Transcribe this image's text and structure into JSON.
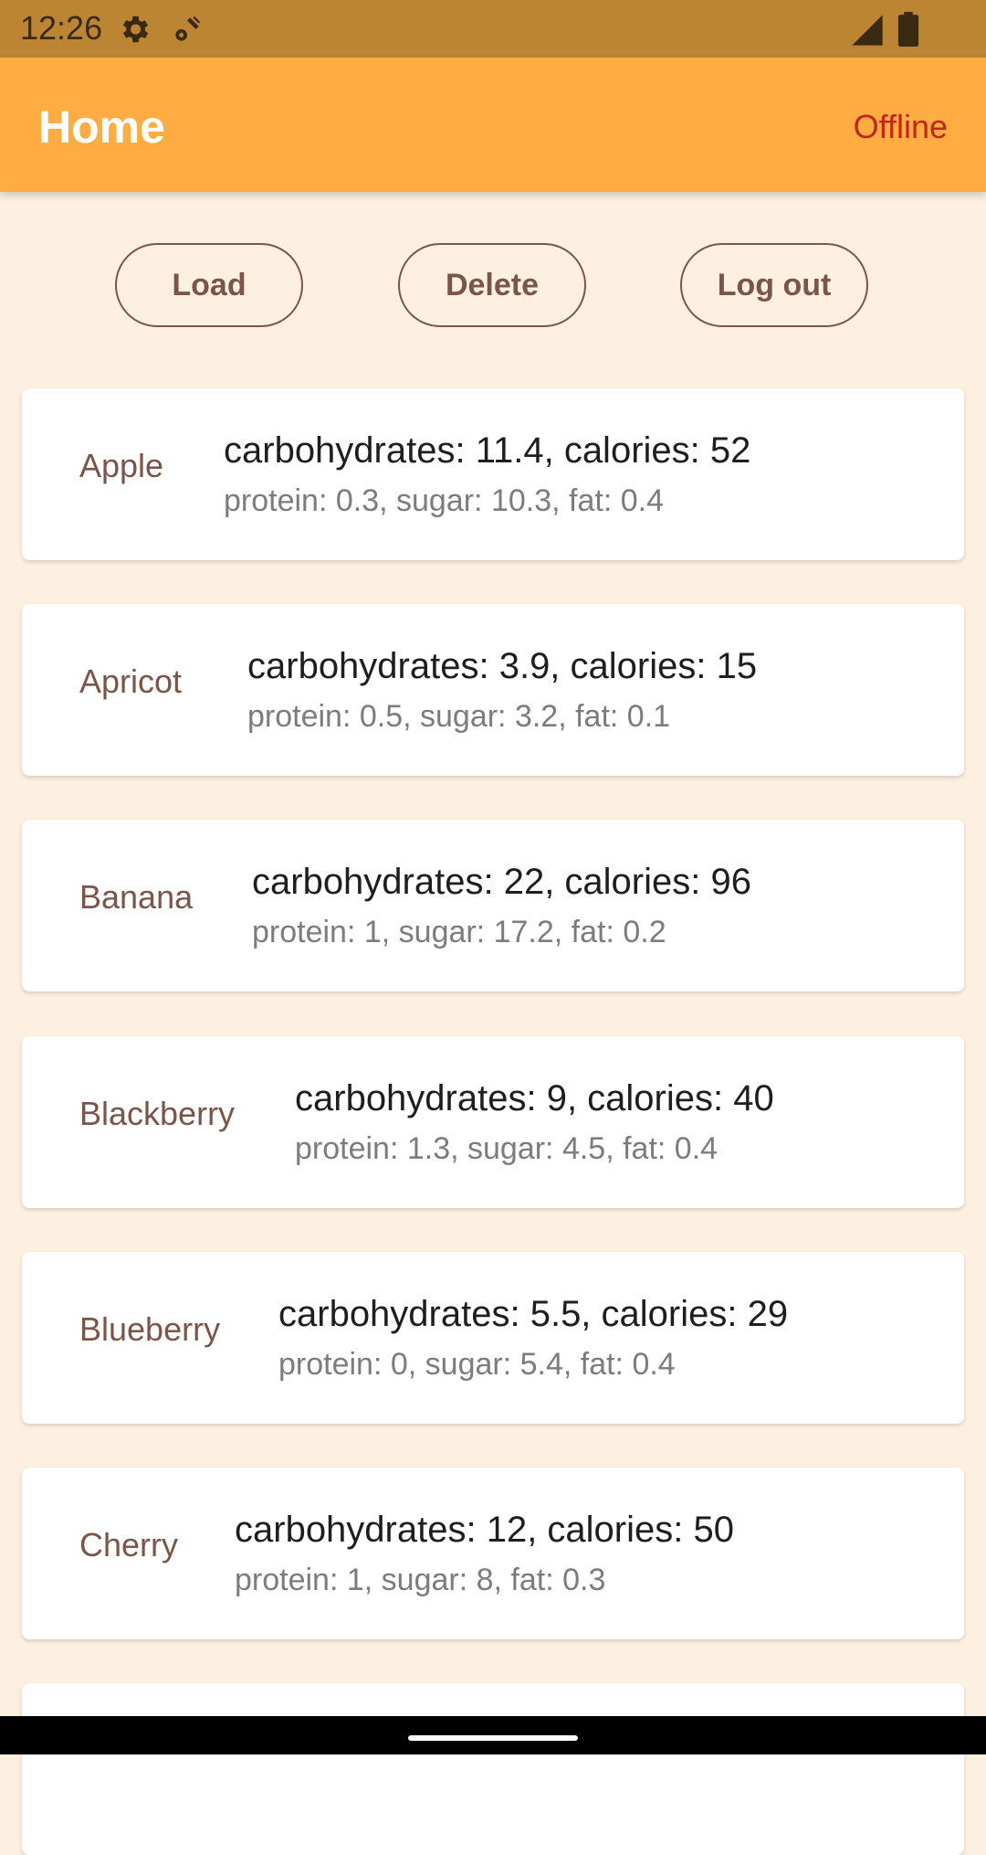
{
  "status_bar": {
    "time": "12:26"
  },
  "app_bar": {
    "title": "Home",
    "connection_status": "Offline"
  },
  "actions": {
    "load": "Load",
    "delete": "Delete",
    "logout": "Log out"
  },
  "foods": [
    {
      "name": "Apple",
      "main": "carbohydrates: 11.4, calories: 52",
      "sub": "protein: 0.3, sugar: 10.3, fat: 0.4"
    },
    {
      "name": "Apricot",
      "main": "carbohydrates: 3.9, calories: 15",
      "sub": "protein: 0.5, sugar: 3.2, fat: 0.1"
    },
    {
      "name": "Banana",
      "main": "carbohydrates: 22, calories: 96",
      "sub": "protein: 1, sugar: 17.2, fat: 0.2"
    },
    {
      "name": "Blackberry",
      "main": "carbohydrates: 9, calories: 40",
      "sub": "protein: 1.3, sugar: 4.5, fat: 0.4"
    },
    {
      "name": "Blueberry",
      "main": "carbohydrates: 5.5, calories: 29",
      "sub": "protein: 0, sugar: 5.4, fat: 0.4"
    },
    {
      "name": "Cherry",
      "main": "carbohydrates: 12, calories: 50",
      "sub": "protein: 1, sugar: 8, fat: 0.3"
    }
  ],
  "colors": {
    "app_bar": "#ffac42",
    "status_bar": "#bb8533",
    "background": "#fdf0e0",
    "accent": "#7a5548",
    "offline": "#c2261b"
  }
}
